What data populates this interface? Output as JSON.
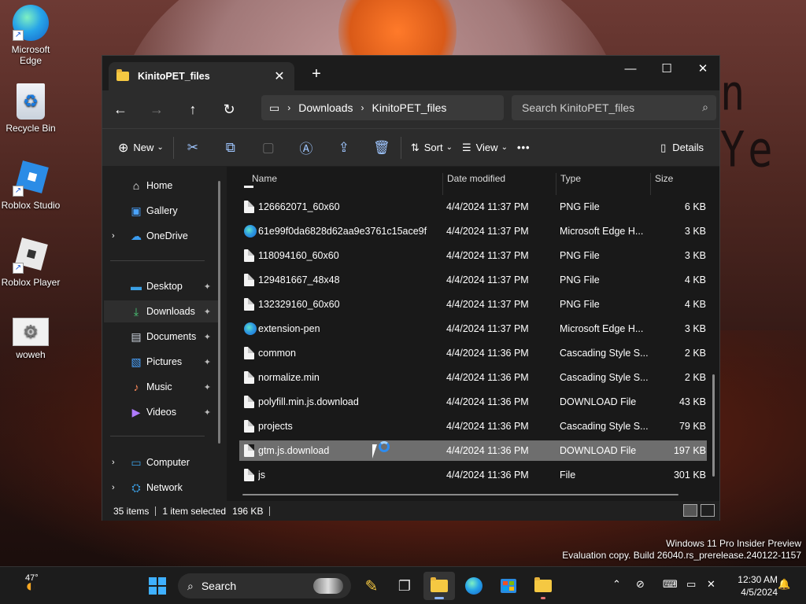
{
  "desktop": {
    "wallpaper_text": "n Ye",
    "icons": [
      {
        "label": "Microsoft Edge",
        "icon": "edge-icon"
      },
      {
        "label": "Recycle Bin",
        "icon": "recycle-bin-icon"
      },
      {
        "label": "Roblox Studio",
        "icon": "roblox-studio-icon"
      },
      {
        "label": "Roblox Player",
        "icon": "roblox-player-icon"
      },
      {
        "label": "woweh",
        "icon": "settings-file-icon"
      }
    ],
    "watermark": {
      "line1": "Windows 11 Pro Insider Preview",
      "line2": "Evaluation copy. Build 26040.rs_prerelease.240122-1157"
    }
  },
  "explorer": {
    "tab_title": "KinitoPET_files",
    "new_tab": "+",
    "window_controls": {
      "minimize": "—",
      "maximize": "☐",
      "close": "✕"
    },
    "breadcrumb": [
      "Downloads",
      "KinitoPET_files"
    ],
    "search_placeholder": "Search KinitoPET_files",
    "toolbar": {
      "new": "New",
      "sort": "Sort",
      "view": "View",
      "more": "•••",
      "details": "Details"
    },
    "nav": {
      "home": "Home",
      "gallery": "Gallery",
      "onedrive": "OneDrive",
      "desktop": "Desktop",
      "downloads": "Downloads",
      "documents": "Documents",
      "pictures": "Pictures",
      "music": "Music",
      "videos": "Videos",
      "computer": "Computer",
      "network": "Network"
    },
    "columns": {
      "name": "Name",
      "date": "Date modified",
      "type": "Type",
      "size": "Size"
    },
    "files": [
      {
        "name": "126662071_60x60",
        "date": "4/4/2024 11:37 PM",
        "type": "PNG File",
        "size": "6 KB",
        "icon": "file"
      },
      {
        "name": "61e99f0da6828d62aa9e3761c15ace9f",
        "date": "4/4/2024 11:37 PM",
        "type": "Microsoft Edge H...",
        "size": "3 KB",
        "icon": "edge"
      },
      {
        "name": "118094160_60x60",
        "date": "4/4/2024 11:37 PM",
        "type": "PNG File",
        "size": "3 KB",
        "icon": "file"
      },
      {
        "name": "129481667_48x48",
        "date": "4/4/2024 11:37 PM",
        "type": "PNG File",
        "size": "4 KB",
        "icon": "file"
      },
      {
        "name": "132329160_60x60",
        "date": "4/4/2024 11:37 PM",
        "type": "PNG File",
        "size": "4 KB",
        "icon": "file"
      },
      {
        "name": "extension-pen",
        "date": "4/4/2024 11:37 PM",
        "type": "Microsoft Edge H...",
        "size": "3 KB",
        "icon": "edge"
      },
      {
        "name": "common",
        "date": "4/4/2024 11:36 PM",
        "type": "Cascading Style S...",
        "size": "2 KB",
        "icon": "file"
      },
      {
        "name": "normalize.min",
        "date": "4/4/2024 11:36 PM",
        "type": "Cascading Style S...",
        "size": "2 KB",
        "icon": "file"
      },
      {
        "name": "polyfill.min.js.download",
        "date": "4/4/2024 11:36 PM",
        "type": "DOWNLOAD File",
        "size": "43 KB",
        "icon": "file"
      },
      {
        "name": "projects",
        "date": "4/4/2024 11:36 PM",
        "type": "Cascading Style S...",
        "size": "79 KB",
        "icon": "file"
      },
      {
        "name": "gtm.js.download",
        "date": "4/4/2024 11:36 PM",
        "type": "DOWNLOAD File",
        "size": "197 KB",
        "icon": "file",
        "selected": true
      },
      {
        "name": "js",
        "date": "4/4/2024 11:36 PM",
        "type": "File",
        "size": "301 KB",
        "icon": "file"
      }
    ],
    "status": {
      "count": "35 items",
      "selected": "1 item selected",
      "size": "196 KB"
    }
  },
  "taskbar": {
    "weather": "47°",
    "search": "Search",
    "clock_time": "12:30 AM",
    "clock_date": "4/5/2024"
  },
  "colors": {
    "accent": "#2d8cf0",
    "selection": "#6e6e6e",
    "folder": "#f5c842"
  }
}
